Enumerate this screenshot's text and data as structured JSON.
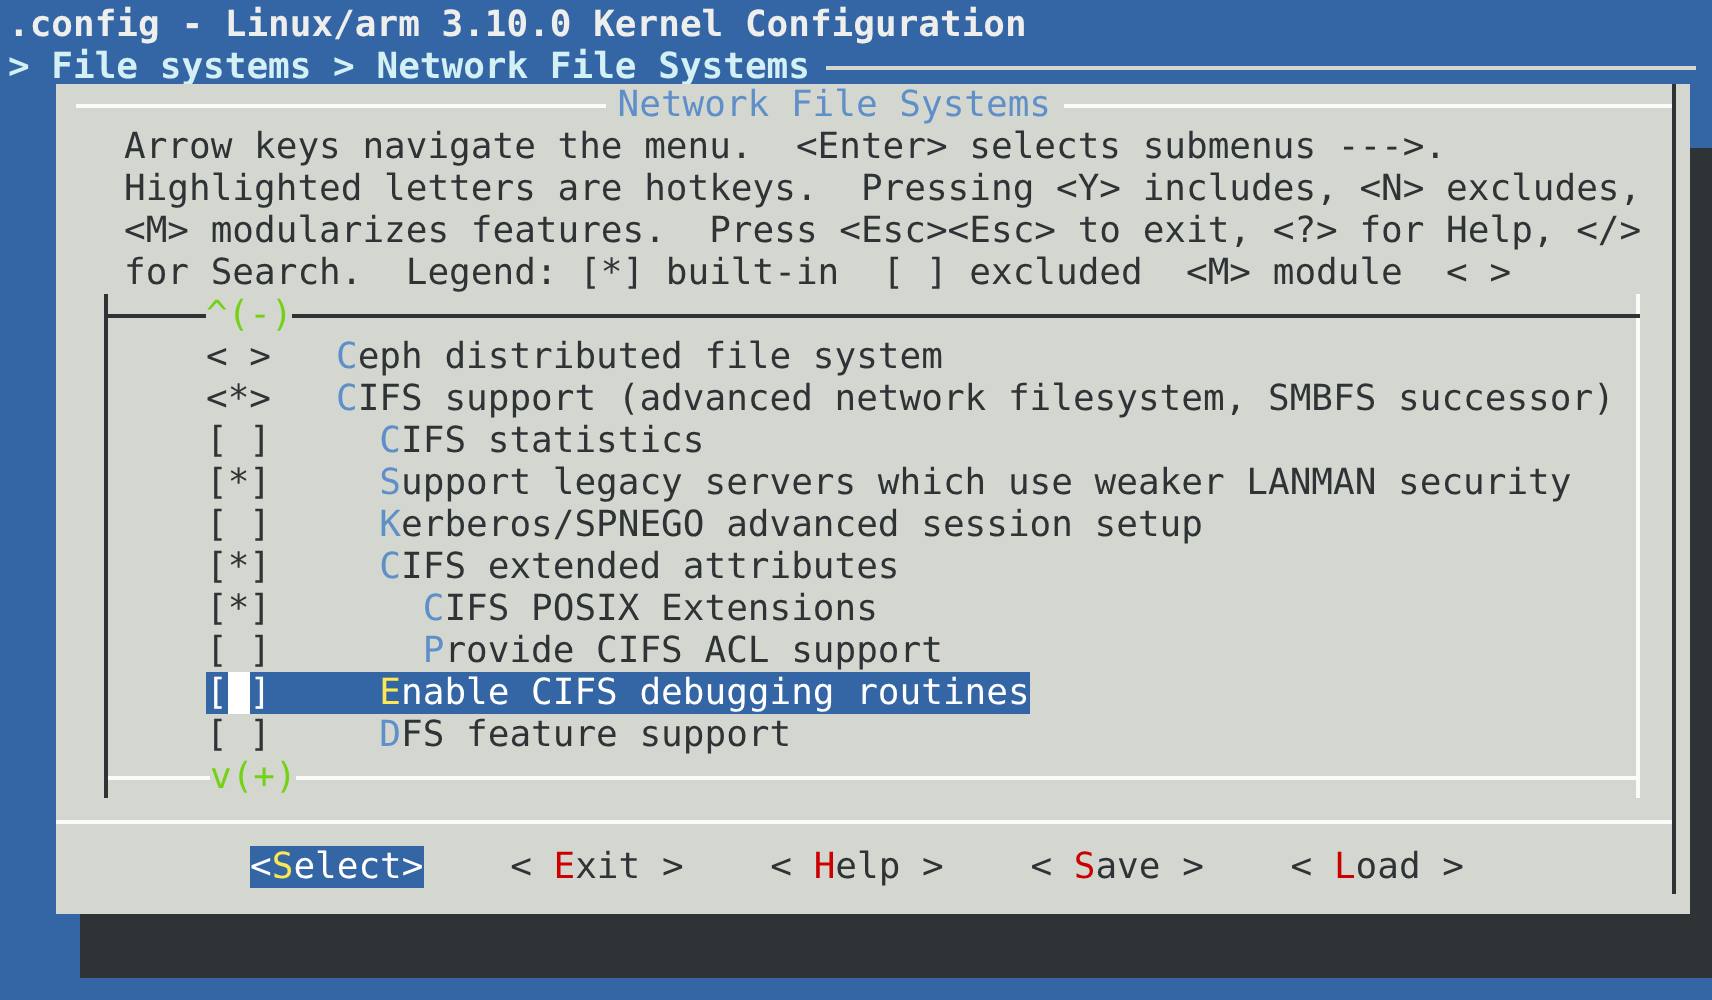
{
  "window": {
    "title": ".config - Linux/arm 3.10.0 Kernel Configuration"
  },
  "breadcrumb": "> File systems > Network File Systems",
  "dialog": {
    "title": "Network File Systems",
    "help_lines": [
      "Arrow keys navigate the menu.  <Enter> selects submenus --->.",
      "Highlighted letters are hotkeys.  Pressing <Y> includes, <N> excludes,",
      "<M> modularizes features.  Press <Esc><Esc> to exit, <?> for Help, </>",
      "for Search.  Legend: [*] built-in  [ ] excluded  <M> module  < >"
    ],
    "menu": {
      "scroll_up": "^(-)",
      "scroll_down": "v(+)",
      "items": [
        {
          "marker": "< >",
          "label": "Ceph distributed file system",
          "selected": false
        },
        {
          "marker": "<*>",
          "label": "CIFS support (advanced network filesystem, SMBFS successor)",
          "selected": false,
          "children": [
            {
              "marker": "[ ]",
              "label": "CIFS statistics",
              "selected": false
            },
            {
              "marker": "[*]",
              "label": "Support legacy servers which use weaker LANMAN security",
              "selected": false
            },
            {
              "marker": "[ ]",
              "label": "Kerberos/SPNEGO advanced session setup",
              "selected": false
            },
            {
              "marker": "[*]",
              "label": "CIFS extended attributes",
              "selected": false,
              "children": [
                {
                  "marker": "[*]",
                  "label": "CIFS POSIX Extensions",
                  "selected": false
                },
                {
                  "marker": "[ ]",
                  "label": "Provide CIFS ACL support",
                  "selected": false
                }
              ]
            },
            {
              "marker": "[ ]",
              "label": "Enable CIFS debugging routines",
              "selected": true
            },
            {
              "marker": "[ ]",
              "label": "DFS feature support",
              "selected": false
            }
          ]
        }
      ]
    },
    "buttons": [
      {
        "text": "<Select>",
        "selected": true
      },
      {
        "text": "< Exit >",
        "selected": false
      },
      {
        "text": "< Help >",
        "selected": false
      },
      {
        "text": "< Save >",
        "selected": false
      },
      {
        "text": "< Load >",
        "selected": false
      }
    ]
  }
}
